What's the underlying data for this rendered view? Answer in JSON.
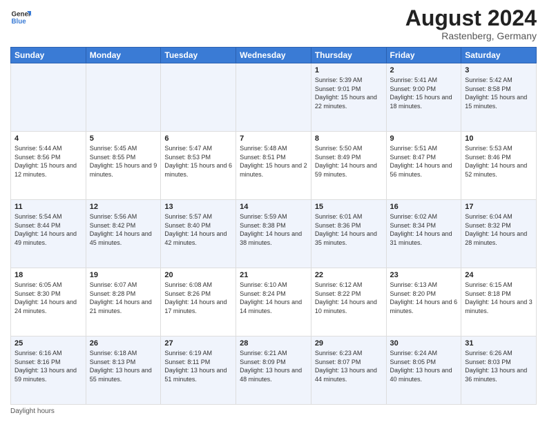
{
  "header": {
    "logo_general": "General",
    "logo_blue": "Blue",
    "month_year": "August 2024",
    "location": "Rastenberg, Germany"
  },
  "weekdays": [
    "Sunday",
    "Monday",
    "Tuesday",
    "Wednesday",
    "Thursday",
    "Friday",
    "Saturday"
  ],
  "weeks": [
    [
      {
        "day": "",
        "info": ""
      },
      {
        "day": "",
        "info": ""
      },
      {
        "day": "",
        "info": ""
      },
      {
        "day": "",
        "info": ""
      },
      {
        "day": "1",
        "info": "Sunrise: 5:39 AM\nSunset: 9:01 PM\nDaylight: 15 hours and 22 minutes."
      },
      {
        "day": "2",
        "info": "Sunrise: 5:41 AM\nSunset: 9:00 PM\nDaylight: 15 hours and 18 minutes."
      },
      {
        "day": "3",
        "info": "Sunrise: 5:42 AM\nSunset: 8:58 PM\nDaylight: 15 hours and 15 minutes."
      }
    ],
    [
      {
        "day": "4",
        "info": "Sunrise: 5:44 AM\nSunset: 8:56 PM\nDaylight: 15 hours and 12 minutes."
      },
      {
        "day": "5",
        "info": "Sunrise: 5:45 AM\nSunset: 8:55 PM\nDaylight: 15 hours and 9 minutes."
      },
      {
        "day": "6",
        "info": "Sunrise: 5:47 AM\nSunset: 8:53 PM\nDaylight: 15 hours and 6 minutes."
      },
      {
        "day": "7",
        "info": "Sunrise: 5:48 AM\nSunset: 8:51 PM\nDaylight: 15 hours and 2 minutes."
      },
      {
        "day": "8",
        "info": "Sunrise: 5:50 AM\nSunset: 8:49 PM\nDaylight: 14 hours and 59 minutes."
      },
      {
        "day": "9",
        "info": "Sunrise: 5:51 AM\nSunset: 8:47 PM\nDaylight: 14 hours and 56 minutes."
      },
      {
        "day": "10",
        "info": "Sunrise: 5:53 AM\nSunset: 8:46 PM\nDaylight: 14 hours and 52 minutes."
      }
    ],
    [
      {
        "day": "11",
        "info": "Sunrise: 5:54 AM\nSunset: 8:44 PM\nDaylight: 14 hours and 49 minutes."
      },
      {
        "day": "12",
        "info": "Sunrise: 5:56 AM\nSunset: 8:42 PM\nDaylight: 14 hours and 45 minutes."
      },
      {
        "day": "13",
        "info": "Sunrise: 5:57 AM\nSunset: 8:40 PM\nDaylight: 14 hours and 42 minutes."
      },
      {
        "day": "14",
        "info": "Sunrise: 5:59 AM\nSunset: 8:38 PM\nDaylight: 14 hours and 38 minutes."
      },
      {
        "day": "15",
        "info": "Sunrise: 6:01 AM\nSunset: 8:36 PM\nDaylight: 14 hours and 35 minutes."
      },
      {
        "day": "16",
        "info": "Sunrise: 6:02 AM\nSunset: 8:34 PM\nDaylight: 14 hours and 31 minutes."
      },
      {
        "day": "17",
        "info": "Sunrise: 6:04 AM\nSunset: 8:32 PM\nDaylight: 14 hours and 28 minutes."
      }
    ],
    [
      {
        "day": "18",
        "info": "Sunrise: 6:05 AM\nSunset: 8:30 PM\nDaylight: 14 hours and 24 minutes."
      },
      {
        "day": "19",
        "info": "Sunrise: 6:07 AM\nSunset: 8:28 PM\nDaylight: 14 hours and 21 minutes."
      },
      {
        "day": "20",
        "info": "Sunrise: 6:08 AM\nSunset: 8:26 PM\nDaylight: 14 hours and 17 minutes."
      },
      {
        "day": "21",
        "info": "Sunrise: 6:10 AM\nSunset: 8:24 PM\nDaylight: 14 hours and 14 minutes."
      },
      {
        "day": "22",
        "info": "Sunrise: 6:12 AM\nSunset: 8:22 PM\nDaylight: 14 hours and 10 minutes."
      },
      {
        "day": "23",
        "info": "Sunrise: 6:13 AM\nSunset: 8:20 PM\nDaylight: 14 hours and 6 minutes."
      },
      {
        "day": "24",
        "info": "Sunrise: 6:15 AM\nSunset: 8:18 PM\nDaylight: 14 hours and 3 minutes."
      }
    ],
    [
      {
        "day": "25",
        "info": "Sunrise: 6:16 AM\nSunset: 8:16 PM\nDaylight: 13 hours and 59 minutes."
      },
      {
        "day": "26",
        "info": "Sunrise: 6:18 AM\nSunset: 8:13 PM\nDaylight: 13 hours and 55 minutes."
      },
      {
        "day": "27",
        "info": "Sunrise: 6:19 AM\nSunset: 8:11 PM\nDaylight: 13 hours and 51 minutes."
      },
      {
        "day": "28",
        "info": "Sunrise: 6:21 AM\nSunset: 8:09 PM\nDaylight: 13 hours and 48 minutes."
      },
      {
        "day": "29",
        "info": "Sunrise: 6:23 AM\nSunset: 8:07 PM\nDaylight: 13 hours and 44 minutes."
      },
      {
        "day": "30",
        "info": "Sunrise: 6:24 AM\nSunset: 8:05 PM\nDaylight: 13 hours and 40 minutes."
      },
      {
        "day": "31",
        "info": "Sunrise: 6:26 AM\nSunset: 8:03 PM\nDaylight: 13 hours and 36 minutes."
      }
    ]
  ],
  "footer": {
    "note": "Daylight hours"
  }
}
